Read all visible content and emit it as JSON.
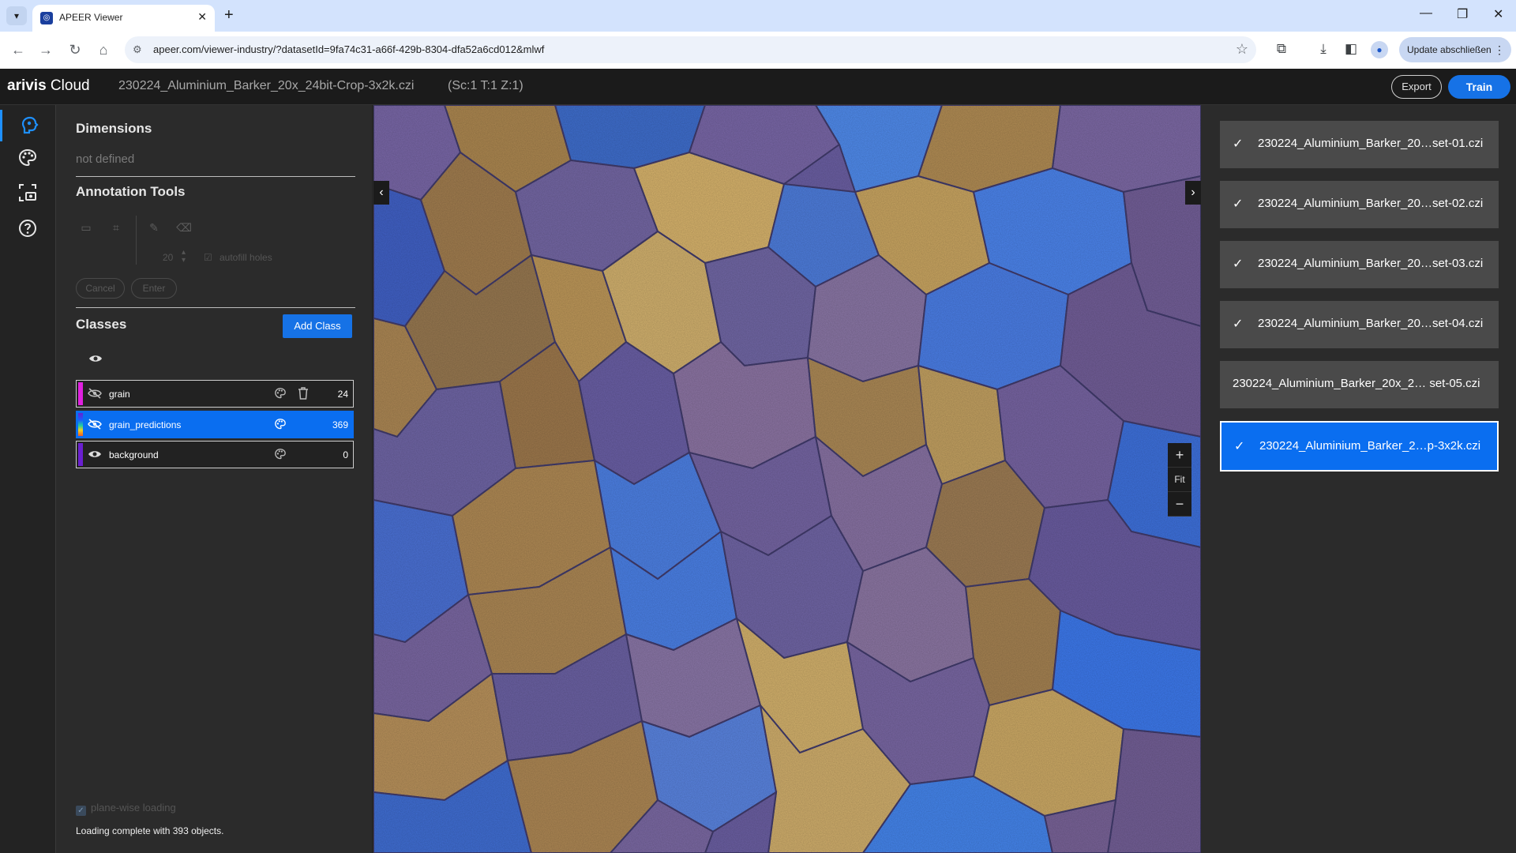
{
  "browser": {
    "tab_title": "APEER Viewer",
    "new_tab": "+",
    "url": "apeer.com/viewer-industry/?datasetId=9fa74c31-a66f-429b-8304-dfa52a6cd012&mlwf",
    "update_label": "Update abschließen"
  },
  "app": {
    "brand_bold": "arivis",
    "brand_rest": " Cloud",
    "file_title": "230224_Aluminium_Barker_20x_24bit-Crop-3x2k.czi",
    "dimensions_readout": "(Sc:1 T:1 Z:1)",
    "export_label": "Export",
    "train_label": "Train"
  },
  "left_panel": {
    "dimensions_title": "Dimensions",
    "dimensions_value": "not defined",
    "annotation_title": "Annotation Tools",
    "brush_size": "20",
    "autofill_label": "autofill holes",
    "cancel_label": "Cancel",
    "enter_label": "Enter",
    "classes_title": "Classes",
    "add_class_label": "Add Class",
    "classes": [
      {
        "name": "grain",
        "count": "24",
        "color": "#e020e0"
      },
      {
        "name": "grain_predictions",
        "count": "369",
        "color": "#f05a28"
      },
      {
        "name": "background",
        "count": "0",
        "color": "#6a1fd0"
      }
    ],
    "plane_wise_label": "plane-wise loading",
    "status": "Loading complete with 393 objects."
  },
  "viewer": {
    "prev": "‹",
    "next": "›",
    "zoom_in": "+",
    "fit": "Fit",
    "zoom_out": "−"
  },
  "datasets": [
    {
      "label": "230224_Aluminium_Barker_20…set-01.czi",
      "checked": true
    },
    {
      "label": "230224_Aluminium_Barker_20…set-02.czi",
      "checked": true
    },
    {
      "label": "230224_Aluminium_Barker_20…set-03.czi",
      "checked": true
    },
    {
      "label": "230224_Aluminium_Barker_20…set-04.czi",
      "checked": true
    },
    {
      "label": "230224_Aluminium_Barker_20x_2… set-05.czi",
      "checked": false
    },
    {
      "label": "230224_Aluminium_Barker_2…p-3x2k.czi",
      "checked": true
    }
  ],
  "icons": [
    "chevron-down-icon",
    "favicon-icon",
    "close-icon",
    "back-icon",
    "forward-icon",
    "reload-icon",
    "home-icon",
    "site-info-icon",
    "star-icon",
    "extensions-icon",
    "download-icon",
    "sidepanel-icon",
    "profile-icon",
    "more-icon",
    "brain-icon",
    "palette-icon",
    "camera-icon",
    "help-icon",
    "eye-icon",
    "eye-off-icon",
    "trash-icon",
    "check-icon",
    "rect-tool-icon",
    "polygon-tool-icon",
    "brush-icon",
    "eraser-icon"
  ]
}
